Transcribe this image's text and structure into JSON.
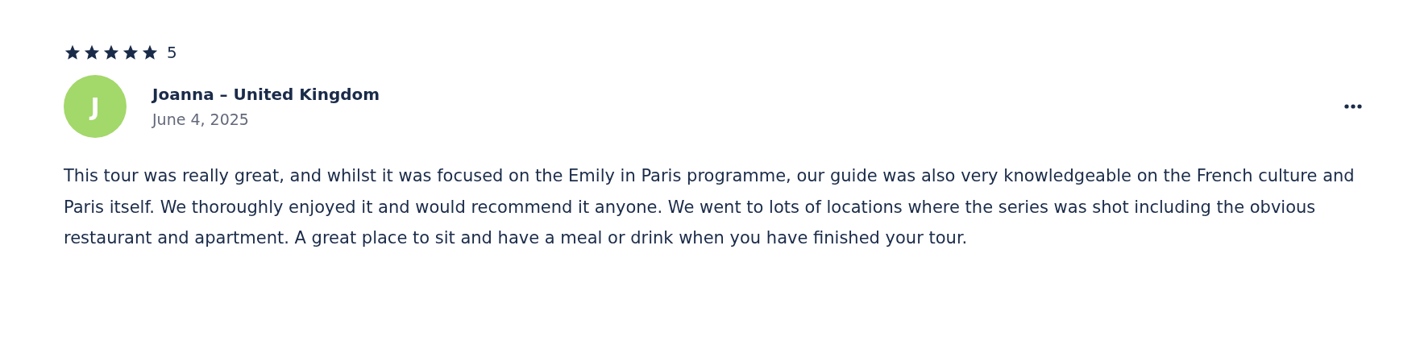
{
  "review": {
    "rating": {
      "stars": 5,
      "label": "5"
    },
    "author": {
      "initial": "J",
      "color": "#a3d86a",
      "name": "Joanna – United Kingdom",
      "date": "June 4, 2025"
    },
    "text": "This tour was really great, and whilst it was focused on the Emily in Paris programme, our guide was also very knowledgeable on the French culture and Paris itself. We thoroughly enjoyed it and would recommend it anyone. We went to lots of locations where the series was shot including the obvious restaurant and apartment. A great place to sit and have a meal or drink when you have finished your tour."
  }
}
